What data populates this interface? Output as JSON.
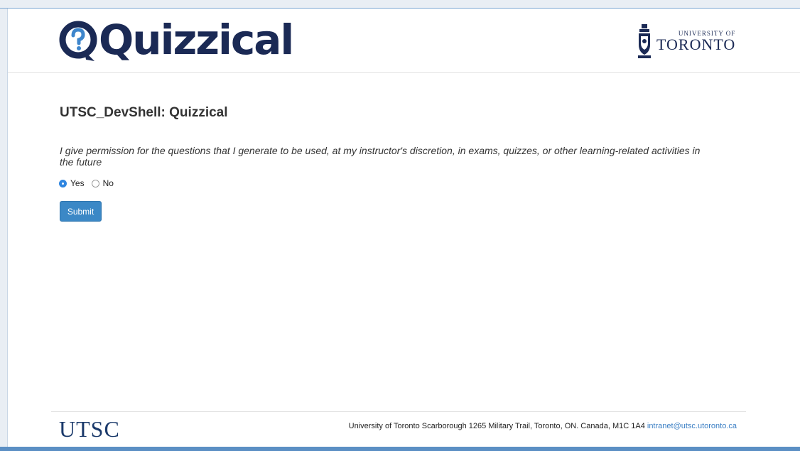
{
  "header": {
    "app_logo_text": "Quizzical",
    "institution_small": "UNIVERSITY OF",
    "institution_big": "TORONTO"
  },
  "main": {
    "course_title": "UTSC_DevShell: Quizzical",
    "permission_text": "I give permission for the questions that I generate to be used, at my instructor's discretion, in exams, quizzes, or other learning-related activities in the future",
    "options": [
      {
        "label": "Yes",
        "selected": true
      },
      {
        "label": "No",
        "selected": false
      }
    ],
    "submit_label": "Submit"
  },
  "footer": {
    "logo_text": "UTSC",
    "address": "University of Toronto Scarborough 1265 Military Trail, Toronto, ON. Canada, M1C 1A4",
    "email": "intranet@utsc.utoronto.ca"
  },
  "colors": {
    "brand_navy": "#1b2a55",
    "button_blue": "#3b88c6",
    "link_blue": "#3b7fc4",
    "radio_selected": "#2f86e0"
  },
  "icons": {
    "app_logo_mark": "speech-bubble-question-icon",
    "institution_crest": "coat-of-arms-icon"
  }
}
